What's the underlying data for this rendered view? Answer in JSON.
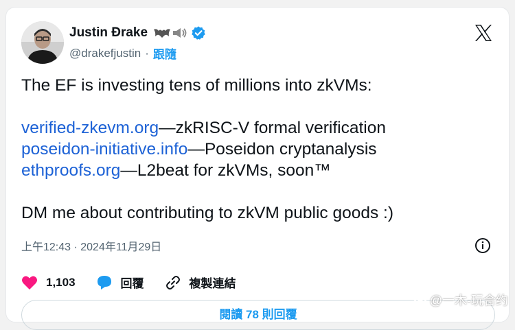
{
  "author": {
    "name": "Justin Ðrake",
    "handle": "@drakefjustin",
    "follow_label": "跟隨",
    "emoji_icons": [
      "bat-icon",
      "speaker-icon"
    ],
    "verified_color": "#1d9bf0"
  },
  "tweet": {
    "line1": "The EF is investing tens of millions into zkVMs:",
    "links": [
      {
        "link": "verified-zkevm.org",
        "rest": "—zkRISC-V formal verification"
      },
      {
        "link": "poseidon-initiative.info",
        "rest": "—Poseidon cryptanalysis"
      },
      {
        "link": "ethproofs.org",
        "rest": "—L2beat for zkVMs, soon™"
      }
    ],
    "line_last": "DM me about contributing to zkVM public goods :)"
  },
  "meta": {
    "timestamp": "上午12:43 · 2024年11月29日"
  },
  "actions": {
    "likes": "1,103",
    "reply_label": "回覆",
    "copy_link_label": "複製連結"
  },
  "read_replies_label": "閱讀 78 則回覆",
  "watermark": "@一木-玩合约",
  "colors": {
    "link": "#1d62d6",
    "accent": "#1d9bf0",
    "heart": "#f91880"
  }
}
